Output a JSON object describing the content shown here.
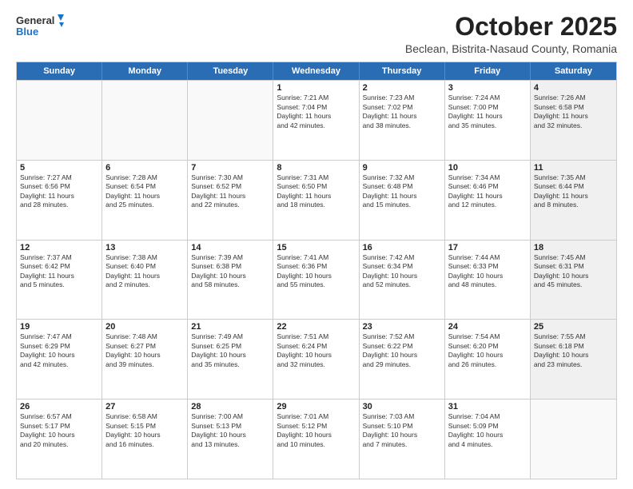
{
  "logo": {
    "general": "General",
    "blue": "Blue"
  },
  "header": {
    "month": "October 2025",
    "location": "Beclean, Bistrita-Nasaud County, Romania"
  },
  "days": [
    "Sunday",
    "Monday",
    "Tuesday",
    "Wednesday",
    "Thursday",
    "Friday",
    "Saturday"
  ],
  "rows": [
    [
      {
        "num": "",
        "lines": []
      },
      {
        "num": "",
        "lines": []
      },
      {
        "num": "",
        "lines": []
      },
      {
        "num": "1",
        "lines": [
          "Sunrise: 7:21 AM",
          "Sunset: 7:04 PM",
          "Daylight: 11 hours",
          "and 42 minutes."
        ]
      },
      {
        "num": "2",
        "lines": [
          "Sunrise: 7:23 AM",
          "Sunset: 7:02 PM",
          "Daylight: 11 hours",
          "and 38 minutes."
        ]
      },
      {
        "num": "3",
        "lines": [
          "Sunrise: 7:24 AM",
          "Sunset: 7:00 PM",
          "Daylight: 11 hours",
          "and 35 minutes."
        ]
      },
      {
        "num": "4",
        "lines": [
          "Sunrise: 7:26 AM",
          "Sunset: 6:58 PM",
          "Daylight: 11 hours",
          "and 32 minutes."
        ]
      }
    ],
    [
      {
        "num": "5",
        "lines": [
          "Sunrise: 7:27 AM",
          "Sunset: 6:56 PM",
          "Daylight: 11 hours",
          "and 28 minutes."
        ]
      },
      {
        "num": "6",
        "lines": [
          "Sunrise: 7:28 AM",
          "Sunset: 6:54 PM",
          "Daylight: 11 hours",
          "and 25 minutes."
        ]
      },
      {
        "num": "7",
        "lines": [
          "Sunrise: 7:30 AM",
          "Sunset: 6:52 PM",
          "Daylight: 11 hours",
          "and 22 minutes."
        ]
      },
      {
        "num": "8",
        "lines": [
          "Sunrise: 7:31 AM",
          "Sunset: 6:50 PM",
          "Daylight: 11 hours",
          "and 18 minutes."
        ]
      },
      {
        "num": "9",
        "lines": [
          "Sunrise: 7:32 AM",
          "Sunset: 6:48 PM",
          "Daylight: 11 hours",
          "and 15 minutes."
        ]
      },
      {
        "num": "10",
        "lines": [
          "Sunrise: 7:34 AM",
          "Sunset: 6:46 PM",
          "Daylight: 11 hours",
          "and 12 minutes."
        ]
      },
      {
        "num": "11",
        "lines": [
          "Sunrise: 7:35 AM",
          "Sunset: 6:44 PM",
          "Daylight: 11 hours",
          "and 8 minutes."
        ]
      }
    ],
    [
      {
        "num": "12",
        "lines": [
          "Sunrise: 7:37 AM",
          "Sunset: 6:42 PM",
          "Daylight: 11 hours",
          "and 5 minutes."
        ]
      },
      {
        "num": "13",
        "lines": [
          "Sunrise: 7:38 AM",
          "Sunset: 6:40 PM",
          "Daylight: 11 hours",
          "and 2 minutes."
        ]
      },
      {
        "num": "14",
        "lines": [
          "Sunrise: 7:39 AM",
          "Sunset: 6:38 PM",
          "Daylight: 10 hours",
          "and 58 minutes."
        ]
      },
      {
        "num": "15",
        "lines": [
          "Sunrise: 7:41 AM",
          "Sunset: 6:36 PM",
          "Daylight: 10 hours",
          "and 55 minutes."
        ]
      },
      {
        "num": "16",
        "lines": [
          "Sunrise: 7:42 AM",
          "Sunset: 6:34 PM",
          "Daylight: 10 hours",
          "and 52 minutes."
        ]
      },
      {
        "num": "17",
        "lines": [
          "Sunrise: 7:44 AM",
          "Sunset: 6:33 PM",
          "Daylight: 10 hours",
          "and 48 minutes."
        ]
      },
      {
        "num": "18",
        "lines": [
          "Sunrise: 7:45 AM",
          "Sunset: 6:31 PM",
          "Daylight: 10 hours",
          "and 45 minutes."
        ]
      }
    ],
    [
      {
        "num": "19",
        "lines": [
          "Sunrise: 7:47 AM",
          "Sunset: 6:29 PM",
          "Daylight: 10 hours",
          "and 42 minutes."
        ]
      },
      {
        "num": "20",
        "lines": [
          "Sunrise: 7:48 AM",
          "Sunset: 6:27 PM",
          "Daylight: 10 hours",
          "and 39 minutes."
        ]
      },
      {
        "num": "21",
        "lines": [
          "Sunrise: 7:49 AM",
          "Sunset: 6:25 PM",
          "Daylight: 10 hours",
          "and 35 minutes."
        ]
      },
      {
        "num": "22",
        "lines": [
          "Sunrise: 7:51 AM",
          "Sunset: 6:24 PM",
          "Daylight: 10 hours",
          "and 32 minutes."
        ]
      },
      {
        "num": "23",
        "lines": [
          "Sunrise: 7:52 AM",
          "Sunset: 6:22 PM",
          "Daylight: 10 hours",
          "and 29 minutes."
        ]
      },
      {
        "num": "24",
        "lines": [
          "Sunrise: 7:54 AM",
          "Sunset: 6:20 PM",
          "Daylight: 10 hours",
          "and 26 minutes."
        ]
      },
      {
        "num": "25",
        "lines": [
          "Sunrise: 7:55 AM",
          "Sunset: 6:18 PM",
          "Daylight: 10 hours",
          "and 23 minutes."
        ]
      }
    ],
    [
      {
        "num": "26",
        "lines": [
          "Sunrise: 6:57 AM",
          "Sunset: 5:17 PM",
          "Daylight: 10 hours",
          "and 20 minutes."
        ]
      },
      {
        "num": "27",
        "lines": [
          "Sunrise: 6:58 AM",
          "Sunset: 5:15 PM",
          "Daylight: 10 hours",
          "and 16 minutes."
        ]
      },
      {
        "num": "28",
        "lines": [
          "Sunrise: 7:00 AM",
          "Sunset: 5:13 PM",
          "Daylight: 10 hours",
          "and 13 minutes."
        ]
      },
      {
        "num": "29",
        "lines": [
          "Sunrise: 7:01 AM",
          "Sunset: 5:12 PM",
          "Daylight: 10 hours",
          "and 10 minutes."
        ]
      },
      {
        "num": "30",
        "lines": [
          "Sunrise: 7:03 AM",
          "Sunset: 5:10 PM",
          "Daylight: 10 hours",
          "and 7 minutes."
        ]
      },
      {
        "num": "31",
        "lines": [
          "Sunrise: 7:04 AM",
          "Sunset: 5:09 PM",
          "Daylight: 10 hours",
          "and 4 minutes."
        ]
      },
      {
        "num": "",
        "lines": []
      }
    ]
  ]
}
